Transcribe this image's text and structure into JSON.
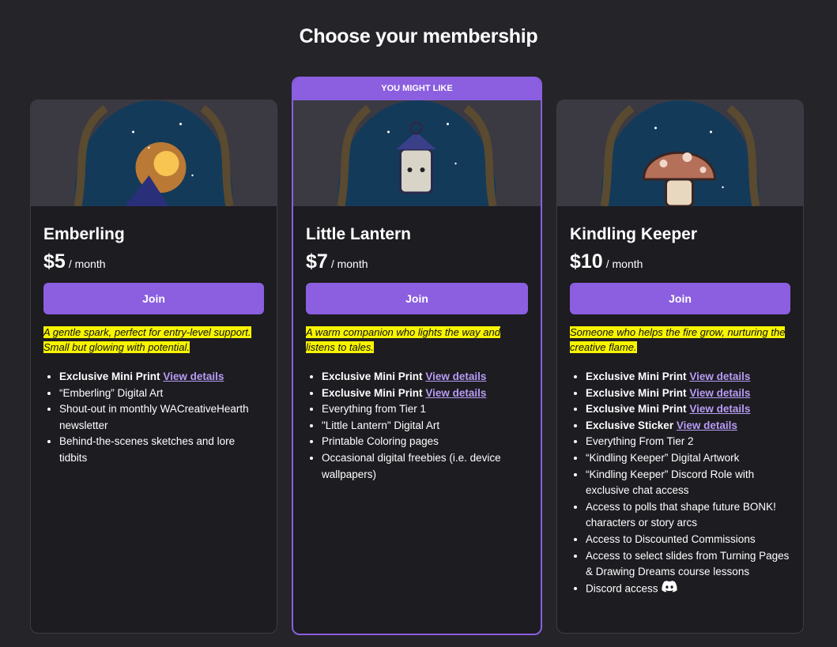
{
  "page": {
    "title": "Choose your membership"
  },
  "colors": {
    "accent": "#8b5fe0",
    "highlight": "#f7f400",
    "link": "#b89cf5"
  },
  "tiers": [
    {
      "name": "Emberling",
      "price": "$5",
      "period": "/ month",
      "join_label": "Join",
      "description": "A gentle spark, perfect for entry-level support. Small but glowing with potential.",
      "perks": [
        {
          "bold": "Exclusive Mini Print",
          "link": "View details",
          "text": ""
        },
        {
          "bold": "",
          "link": "",
          "text": "“Emberling” Digital Art"
        },
        {
          "bold": "",
          "link": "",
          "text": "Shout-out in monthly WACreativeHearth newsletter"
        },
        {
          "bold": "",
          "link": "",
          "text": "Behind-the-scenes sketches and lore tidbits"
        }
      ]
    },
    {
      "name": "Little Lantern",
      "badge": "YOU MIGHT LIKE",
      "price": "$7",
      "period": "/ month",
      "join_label": "Join",
      "description": "A warm companion who lights the way and listens to tales.",
      "perks": [
        {
          "bold": "Exclusive Mini Print",
          "link": "View details",
          "text": ""
        },
        {
          "bold": "Exclusive Mini Print",
          "link": "View details",
          "text": ""
        },
        {
          "bold": "",
          "link": "",
          "text": "Everything from Tier 1"
        },
        {
          "bold": "",
          "link": "",
          "text": "\"Little Lantern\" Digital Art"
        },
        {
          "bold": "",
          "link": "",
          "text": "Printable Coloring pages"
        },
        {
          "bold": "",
          "link": "",
          "text": "Occasional digital freebies (i.e. device wallpapers)"
        }
      ]
    },
    {
      "name": "Kindling Keeper",
      "price": "$10",
      "period": "/ month",
      "join_label": "Join",
      "description": "Someone who helps the fire grow, nurturing the creative flame.",
      "perks": [
        {
          "bold": "Exclusive Mini Print",
          "link": "View details",
          "text": ""
        },
        {
          "bold": "Exclusive Mini Print",
          "link": "View details",
          "text": ""
        },
        {
          "bold": "Exclusive Mini Print",
          "link": "View details",
          "text": ""
        },
        {
          "bold": "Exclusive Sticker",
          "link": "View details",
          "text": ""
        },
        {
          "bold": "",
          "link": "",
          "text": "Everything From Tier 2"
        },
        {
          "bold": "",
          "link": "",
          "text": "“Kindling Keeper” Digital Artwork"
        },
        {
          "bold": "",
          "link": "",
          "text": "“Kindling Keeper” Discord Role with exclusive chat access"
        },
        {
          "bold": "",
          "link": "",
          "text": "Access to polls that shape future BONK! characters or story arcs"
        },
        {
          "bold": "",
          "link": "",
          "text": "Access to Discounted Commissions"
        },
        {
          "bold": "",
          "link": "",
          "text": "Access to select slides from Turning Pages & Drawing Dreams course lessons"
        },
        {
          "bold": "",
          "link": "",
          "text": "Discord access",
          "icon": "discord-icon"
        }
      ]
    }
  ]
}
